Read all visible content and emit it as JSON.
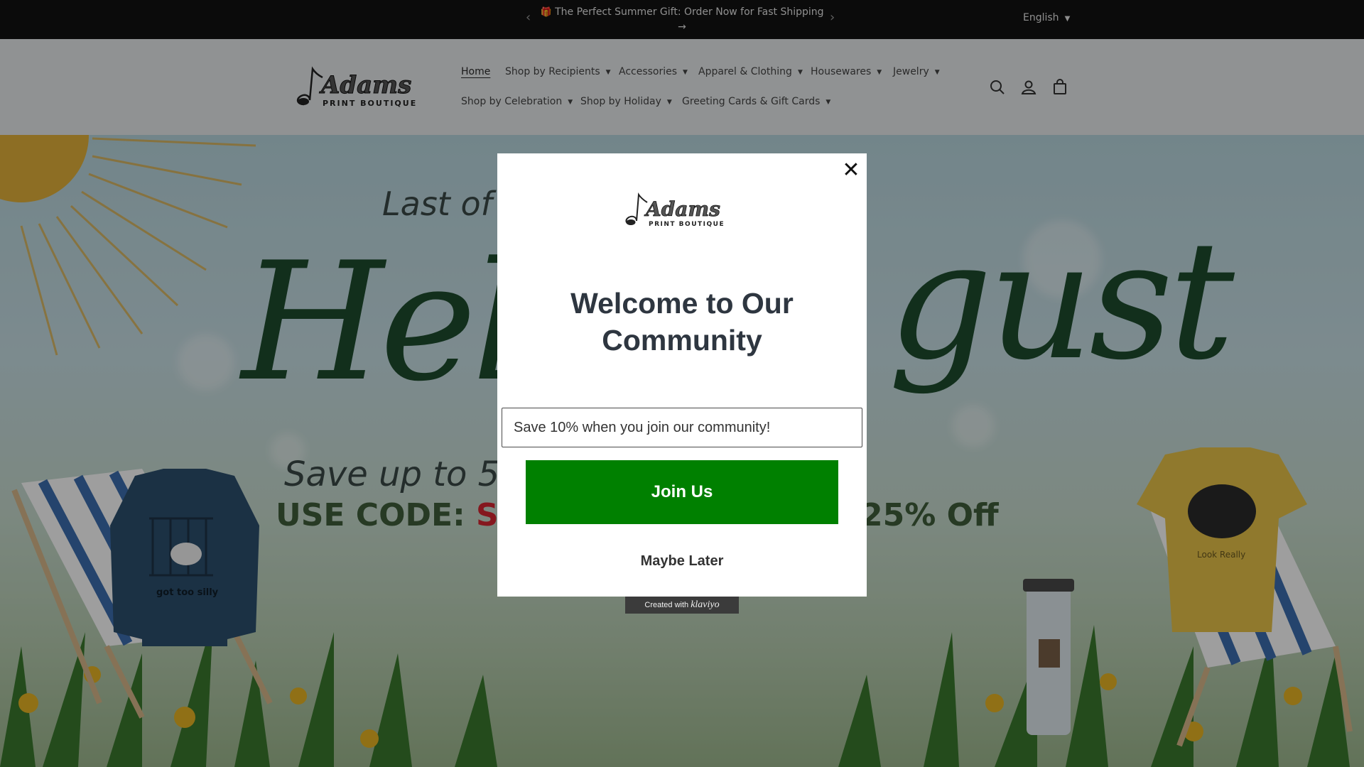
{
  "announcement": {
    "message": "The Perfect Summer Gift: Order Now for Fast Shipping",
    "gift_icon": "🎁",
    "arrow": "→",
    "prev": "‹",
    "next": "›",
    "language": "English"
  },
  "header": {
    "logo_text_top": "Adams",
    "logo_text_bottom": "PRINT BOUTIQUE",
    "menu_row1": [
      "Home",
      "Shop by Recipients",
      "Accessories",
      "Apparel & Clothing",
      "Housewares",
      "Jewelry"
    ],
    "menu_row2": [
      "Shop by Celebration",
      "Shop by Holiday",
      "Greeting Cards & Gift Cards"
    ],
    "chevron": "⌄",
    "icons": [
      "search-icon",
      "account-icon",
      "cart-icon"
    ]
  },
  "hero": {
    "line1": "Last of",
    "line2_left": "Hell",
    "line2_right": "gust",
    "line3": "Save up to 50",
    "code_label": "USE CODE:",
    "code_value": "Su",
    "discount": "25% Off",
    "shirt_left_text": "got too silly",
    "shirt_right_text": "Look Really"
  },
  "popup": {
    "close": "✕",
    "logo_text_top": "Adams",
    "logo_text_bottom": "PRINT BOUTIQUE",
    "title": "Welcome to Our Community",
    "email_placeholder": "Save 10% when you join our community!",
    "join_button": "Join Us",
    "later_button": "Maybe Later",
    "badge_prefix": "Created with",
    "badge_brand": "klaviyo"
  },
  "colors": {
    "announce_bg": "#121212",
    "header_bg": "#e9ecee",
    "join_green": "#008000",
    "code_red": "#d72631",
    "script_green": "#1d4d2e"
  }
}
